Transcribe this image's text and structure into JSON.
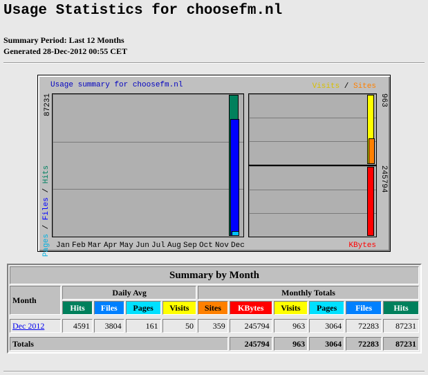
{
  "page": {
    "title": "Usage Statistics for choosefm.nl",
    "summary_period": "Summary Period: Last 12 Months",
    "generated": "Generated 28-Dec-2012 00:55 CET"
  },
  "chart": {
    "title": "Usage summary for choosefm.nl",
    "legend_left": {
      "pages": "Pages",
      "files": "Files",
      "hits": "Hits",
      "sep": " / "
    },
    "legend_right": {
      "visits": "Visits",
      "sep": " / ",
      "sites": "Sites"
    },
    "kbytes_label": "KBytes",
    "max_hits_label": "87231",
    "max_visits_label": "963",
    "max_kbytes_label": "245794",
    "months": [
      "Jan",
      "Feb",
      "Mar",
      "Apr",
      "May",
      "Jun",
      "Jul",
      "Aug",
      "Sep",
      "Oct",
      "Nov",
      "Dec"
    ],
    "colors": {
      "hits": "#00805c",
      "files": "#0000ff",
      "pages": "#00c0ff",
      "visits": "#ffff00",
      "sites": "#ff8000",
      "kbytes": "#ff0000"
    }
  },
  "chart_data": {
    "type": "bar",
    "categories": [
      "Jan",
      "Feb",
      "Mar",
      "Apr",
      "May",
      "Jun",
      "Jul",
      "Aug",
      "Sep",
      "Oct",
      "Nov",
      "Dec"
    ],
    "series": [
      {
        "name": "Hits",
        "values": [
          0,
          0,
          0,
          0,
          0,
          0,
          0,
          0,
          0,
          0,
          0,
          87231
        ]
      },
      {
        "name": "Files",
        "values": [
          0,
          0,
          0,
          0,
          0,
          0,
          0,
          0,
          0,
          0,
          0,
          72283
        ]
      },
      {
        "name": "Pages",
        "values": [
          0,
          0,
          0,
          0,
          0,
          0,
          0,
          0,
          0,
          0,
          0,
          3064
        ]
      },
      {
        "name": "Visits",
        "values": [
          0,
          0,
          0,
          0,
          0,
          0,
          0,
          0,
          0,
          0,
          0,
          963
        ]
      },
      {
        "name": "Sites",
        "values": [
          0,
          0,
          0,
          0,
          0,
          0,
          0,
          0,
          0,
          0,
          0,
          359
        ]
      },
      {
        "name": "KBytes",
        "values": [
          0,
          0,
          0,
          0,
          0,
          0,
          0,
          0,
          0,
          0,
          0,
          245794
        ]
      }
    ],
    "title": "Usage summary for choosefm.nl",
    "ylim_hits": [
      0,
      87231
    ],
    "ylim_visits": [
      0,
      963
    ],
    "ylim_kbytes": [
      0,
      245794
    ],
    "grid": true
  },
  "table": {
    "title": "Summary by Month",
    "month_header": "Month",
    "daily_avg_header": "Daily Avg",
    "monthly_totals_header": "Monthly Totals",
    "daily_cols": [
      "Hits",
      "Files",
      "Pages",
      "Visits"
    ],
    "monthly_cols": [
      "Sites",
      "KBytes",
      "Visits",
      "Pages",
      "Files",
      "Hits"
    ],
    "row": {
      "month": "Dec 2012",
      "daily": [
        "4591",
        "3804",
        "161",
        "50"
      ],
      "monthly": [
        "359",
        "245794",
        "963",
        "3064",
        "72283",
        "87231"
      ]
    },
    "totals": {
      "label": "Totals",
      "kbytes": "245794",
      "visits": "963",
      "pages": "3064",
      "files": "72283",
      "hits": "87231"
    }
  }
}
